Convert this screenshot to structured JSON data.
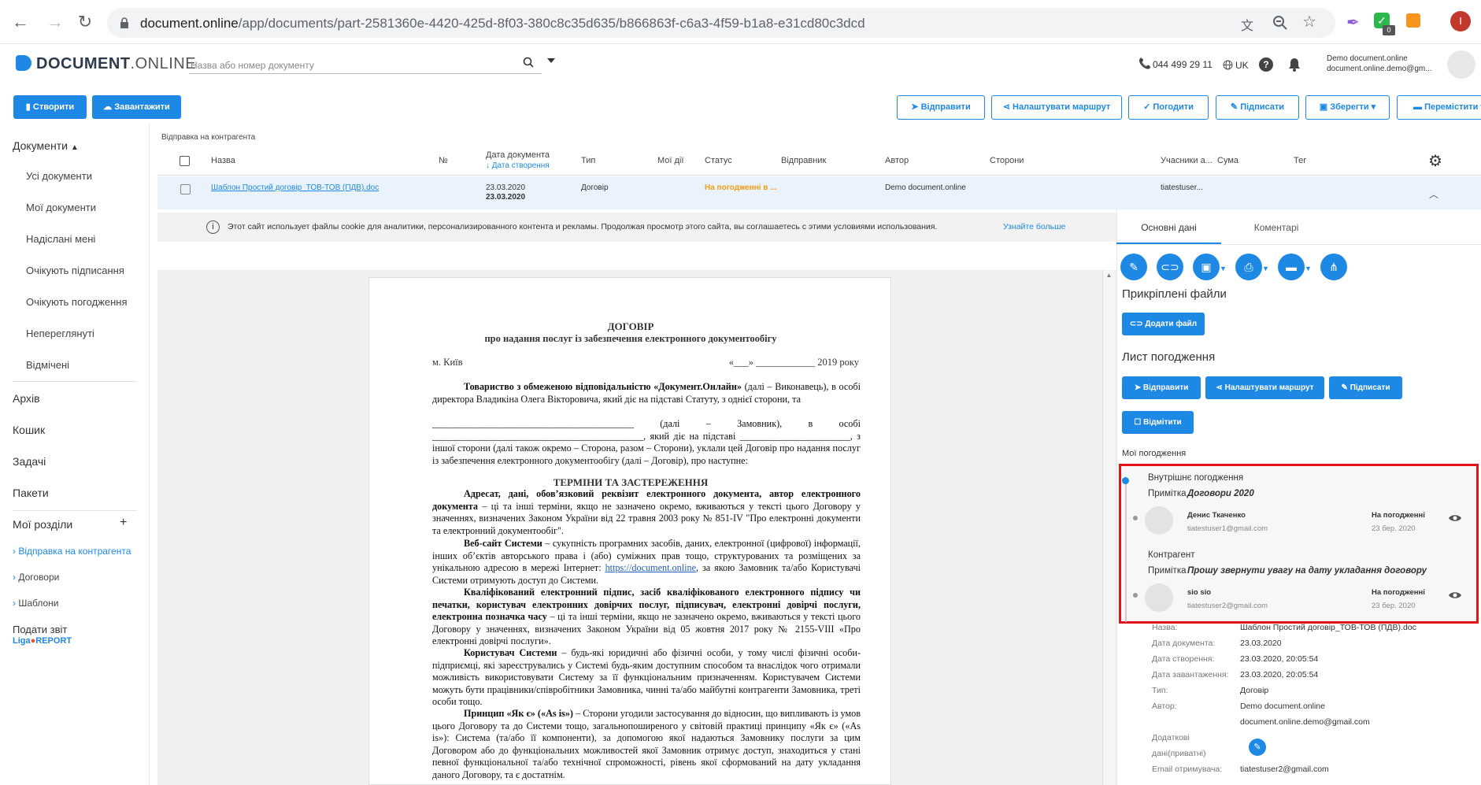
{
  "browser": {
    "url_main": "document.online",
    "url_path": "/app/documents/part-2581360e-4420-425d-8f03-380c8c35d635/b866863f-c6a3-4f59-b1a8-e31cd80c3dcd",
    "ext_badge": "0",
    "profile_initial": "I"
  },
  "header": {
    "logo_bold": "DOCUMENT",
    "logo_light": ".ONLINE",
    "search_placeholder": "Назва або номер документу",
    "phone": "044 499 29 11",
    "lang": "UK",
    "user_name": "Demo document.online",
    "user_email": "document.online.demo@gm..."
  },
  "toolbar": {
    "create": "Створити",
    "upload": "Завантажити",
    "send": "Відправити",
    "route": "Налаштувати маршрут",
    "approve": "Погодити",
    "sign": "Підписати",
    "save": "Зберегти",
    "move": "Перемістити"
  },
  "sidebar": {
    "documents": "Документи",
    "items": [
      "Усі документи",
      "Мої документи",
      "Надіслані мені",
      "Очікують підписання",
      "Очікують погодження",
      "Непереглянуті",
      "Відмічені"
    ],
    "archive": "Архів",
    "trash": "Кошик",
    "tasks": "Задачі",
    "packages": "Пакети",
    "my_sections": "Мої розділи",
    "plus": "+",
    "sub_items": [
      "Відправка на контрагента",
      "Договори",
      "Шаблони"
    ],
    "report_label": "Подати звіт",
    "report_brand_a": "Liga",
    "report_brand_b": "REPORT"
  },
  "table": {
    "breadcrumb": "Відправка на контрагента",
    "headers": {
      "name": "Назва",
      "number": "№",
      "date": "Дата документа",
      "date_sort": "↓ Дата створення",
      "type": "Тип",
      "actions": "Мої дії",
      "status": "Статус",
      "sender": "Відправник",
      "author": "Автор",
      "parties": "Сторони",
      "participants": "Учасники а...",
      "sum": "Сума",
      "tag": "Тег"
    },
    "row": {
      "name": "Шаблон Простий договір_ТОВ-ТОВ (ПДВ).doc",
      "date1": "23.03.2020",
      "date2": "23.03.2020",
      "type": "Договір",
      "status": "На погодженні в ...",
      "author": "Demo document.online",
      "participants": "tiatestuser..."
    }
  },
  "cookie": {
    "text": "Этот сайт использует файлы cookie для аналитики, персонализированного контента и рекламы. Продолжая просмотр этого сайта, вы соглашаетесь с этими условиями использования.",
    "link": "Узнайте больше"
  },
  "document": {
    "title": "ДОГОВІР",
    "subtitle": "про надання послуг із забезпечення електронного документообігу",
    "city": "м. Київ",
    "date_line": "«___» ____________ 2019 року",
    "p1_bold": "Товариство з обмеженою відповідальністю «Документ.Онлайн»",
    "p1": "(далі – Виконавець), в особі директора Владикіна Олега Вікторовича, який діє на підставі Статуту, з однієї сторони, та",
    "p1b": "__________________________________________ (далі – Замовник), в особі ____________________________________________, який діє на підставі _______________________, з іншої сторони (далі також окремо – Сторона, разом – Сторони), уклали цей Договір про надання послуг із забезпечення електронного документообігу (далі – Договір), про наступне:",
    "section": "ТЕРМІНИ ТА ЗАСТЕРЕЖЕННЯ",
    "t1_bold": "Адресат, дані, обов’язковий реквізит електронного документа, автор електронного документа",
    "t1": "– ці та інші терміни, якщо не зазначено окремо, вживаються у тексті цього Договору у значеннях, визначених Законом України від 22 травня 2003 року № 851-IV \"Про електронні документи та електронний документообіг\".",
    "t2_bold": "Веб-сайт Системи",
    "t2": "– сукупність програмних засобів, даних, електронної (цифрової) інформації, інших об’єктів авторського права і (або) суміжних прав тощо, структурованих та розміщених за унікальною адресою в мережі Інтернет:",
    "t2_link": "https://document.online",
    "t2_end": ", за якою Замовник та/або Користувачі Системи отримують доступ до Системи.",
    "t3_bold": "Кваліфікований електронний підпис, засіб кваліфікованого електронного підпису чи печатки, користувач електронних довірчих послуг, підписувач, електронні довірчі послуги, електронна позначка часу",
    "t3": "– ці та інші терміни, якщо не зазначено окремо, вживаються у тексті цього Договору у значеннях, визначених Законом України від 05 жовтня 2017 року № 2155-VIII «Про електронні довірчі послуги».",
    "t4_bold": "Користувач Системи",
    "t4": "– будь-які юридичні або фізичні особи, у тому числі фізичні особи-підприємці, які зареєструвались у Системі будь-яким доступним способом та внаслідок чого отримали можливість використовувати Систему за її функціональним призначенням. Користувачем Системи можуть бути працівники/співробітники Замовника, чинні та/або майбутні контрагенти Замовника, треті особи тощо.",
    "t5_bold": "Принцип «Як є» («As is»)",
    "t5": "– Сторони угодили застосування до відносин, що випливають із умов цього Договору та до Системи тощо, загальнопоширеного у світовій практиці принципу «Як є» («As is»): Система (та/або її компоненти), за допомогою якої надаються Замовнику послуги за цим Договором або до функціональних можливостей якої Замовник отримує доступ, знаходиться у стані певної функціональної та/або технічної спроможності, рівень якої сформований на дату укладання даного Договору, та є достатнім."
  },
  "panel": {
    "tab_main": "Основні дані",
    "tab_comments": "Коментарі",
    "attached_title": "Прикріплені файли",
    "add_file": "Додати файл",
    "approval_sheet": "Лист погодження",
    "send": "Відправити",
    "route": "Налаштувати маршрут",
    "sign": "Підписати",
    "mark": "Відмітити",
    "my_approvals": "Мої погодження",
    "groups": [
      {
        "title": "Внутрішнє погодження",
        "note_label": "Примітка",
        "note": "Договори 2020",
        "person": "Денис Ткаченко",
        "email": "tiatestuser1@gmail.com",
        "status": "На погодженні",
        "date": "23 бер. 2020"
      },
      {
        "title": "Контрагент",
        "note_label": "Примітка",
        "note": "Прошу звернути увагу на дату укладання договору",
        "person": "sio sio",
        "email": "tiatestuser2@gmail.com",
        "status": "На погодженні",
        "date": "23 бер. 2020"
      }
    ],
    "details": {
      "name_label": "Назва:",
      "name": "Шаблон Простий договір_ТОВ-ТОВ (ПДВ).doc",
      "docdate_label": "Дата документа:",
      "docdate": "23.03.2020",
      "created_label": "Дата створення:",
      "created": "23.03.2020, 20:05:54",
      "uploaded_label": "Дата завантаження:",
      "uploaded": "23.03.2020, 20:05:54",
      "type_label": "Тип:",
      "type": "Договір",
      "author_label": "Автор:",
      "author": "Demo document.online",
      "author_email": "document.online.demo@gmail.com",
      "extra_label1": "Додаткові",
      "extra_label2": "дані(приватні)",
      "recipient_label": "Email отримувача:",
      "recipient": "tiatestuser2@gmail.com"
    }
  },
  "colors": {
    "accent": "#1e88e5",
    "status_orange": "#f39c12",
    "highlight_red": "#e3131b"
  }
}
